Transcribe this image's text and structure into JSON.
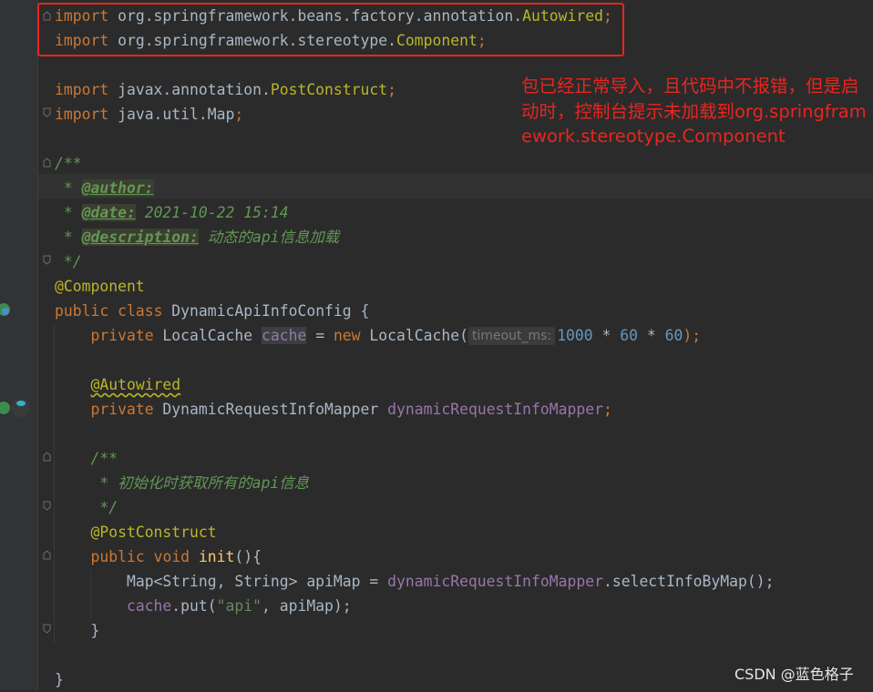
{
  "code": {
    "import1": {
      "kw": "import",
      "pkg": " org.springframework.beans.factory.annotation.",
      "cls": "Autowired",
      "end": ";"
    },
    "import2": {
      "kw": "import",
      "pkg": " org.springframework.stereotype.",
      "cls": "Component",
      "end": ";"
    },
    "import3": {
      "kw": "import",
      "pkg": " javax.annotation.",
      "cls": "PostConstruct",
      "end": ";"
    },
    "import4": {
      "kw": "import",
      "pkg": " java.util.Map",
      "end": ";"
    },
    "doc_open": "/**",
    "doc_author_prefix": " * ",
    "doc_author_tag": "@author:",
    "doc_date_prefix": " * ",
    "doc_date_tag": "@date:",
    "doc_date_value": " 2021-10-22 15:14",
    "doc_desc_prefix": " * ",
    "doc_desc_tag": "@description:",
    "doc_desc_value": " 动态的api信息加载",
    "doc_close": " */",
    "class_annotation": "@Component",
    "class_kw1": "public",
    "class_kw2": "class",
    "class_name": " DynamicApiInfoConfig {",
    "field1_kw": "private",
    "field1_type": " LocalCache ",
    "field1_name": "cache",
    "field1_eq": " = ",
    "field1_new": "new",
    "field1_ctor": " LocalCache(",
    "field1_hint": "timeout_ms:",
    "field1_n1": "1000",
    "field1_op1": " * ",
    "field1_n2": "60",
    "field1_op2": " * ",
    "field1_n3": "60",
    "field1_end": ");",
    "field2_annotation": "@Autowired",
    "field2_kw": "private",
    "field2_type": " DynamicRequestInfoMapper ",
    "field2_name": "dynamicRequestInfoMapper",
    "field2_end": ";",
    "mdoc_open": "/**",
    "mdoc_line": " * 初始化时获取所有的api信息",
    "mdoc_close": " */",
    "method_annotation": "@PostConstruct",
    "method_kw1": "public",
    "method_kw2": "void",
    "method_name": "init",
    "method_sig_end": "(){",
    "body1_a": "Map<String, String> apiMap = ",
    "body1_field": "dynamicRequestInfoMapper",
    "body1_b": ".selectInfoByMap();",
    "body2_field": "cache",
    "body2_a": ".put(",
    "body2_str": "\"api\"",
    "body2_b": ", apiMap);",
    "method_close": "}",
    "class_close": "}"
  },
  "annotation_note": "包已经正常导入，且代码中不报错，但是启动时，控制台提示未加载到org.springframework.stereotype.Component",
  "watermark": "CSDN @蓝色格子",
  "colors": {
    "highlight_box": "#e8261f",
    "background": "#2b2b2b"
  }
}
